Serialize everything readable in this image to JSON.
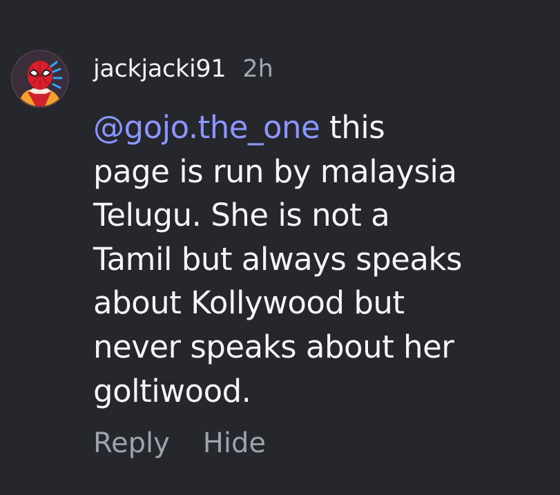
{
  "comment": {
    "username": "jackjacki91",
    "timestamp": "2h",
    "avatar_icon": "spiderman-avatar-icon",
    "mention": "@gojo.the_one",
    "text_lines": [
      "this",
      "page is run by malaysia",
      "Telugu. She is not a",
      "Tamil but always speaks",
      "about Kollywood but",
      "never speaks about her",
      "goltiwood."
    ],
    "mention_color": "#8b96ff"
  },
  "actions": {
    "reply_label": "Reply",
    "hide_label": "Hide"
  }
}
